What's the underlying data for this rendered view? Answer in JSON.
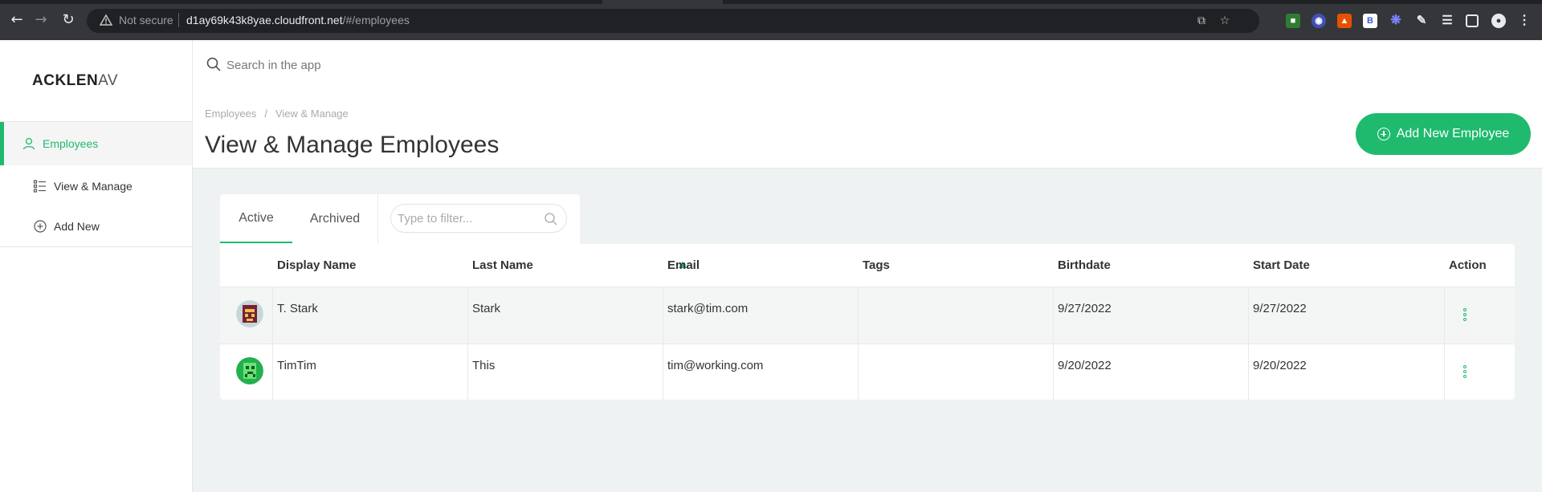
{
  "browser": {
    "security_label": "Not secure",
    "url_host": "d1ay69k43k8yae.cloudfront.net",
    "url_path": "/#/employees",
    "extension_badge": "B"
  },
  "sidebar": {
    "logo_main": "ACKLEN",
    "logo_fade": "AV",
    "items": [
      {
        "label": "Employees",
        "icon": "user-icon"
      },
      {
        "label": "View & Manage",
        "icon": "list-icon"
      },
      {
        "label": "Add New",
        "icon": "plus-circle-icon"
      }
    ]
  },
  "search": {
    "placeholder": "Search in the app"
  },
  "header": {
    "breadcrumb": [
      "Employees",
      "View & Manage"
    ],
    "title": "View & Manage Employees",
    "add_button": "Add New Employee"
  },
  "tabs": [
    "Active",
    "Archived"
  ],
  "filter": {
    "placeholder": "Type to filter..."
  },
  "table": {
    "columns": [
      "Display Name",
      "Last Name",
      "Email",
      "Tags",
      "Birthdate",
      "Start Date",
      "Action"
    ],
    "sorted_column": "Last Name",
    "rows": [
      {
        "display_name": "T. Stark",
        "last_name": "Stark",
        "email": "stark@tim.com",
        "tags": "",
        "birthdate": "9/27/2022",
        "start_date": "9/27/2022"
      },
      {
        "display_name": "TimTim",
        "last_name": "This",
        "email": "tim@working.com",
        "tags": "",
        "birthdate": "9/20/2022",
        "start_date": "9/20/2022"
      }
    ]
  },
  "colors": {
    "accent": "#1fba6e",
    "chrome": "#35363a"
  }
}
